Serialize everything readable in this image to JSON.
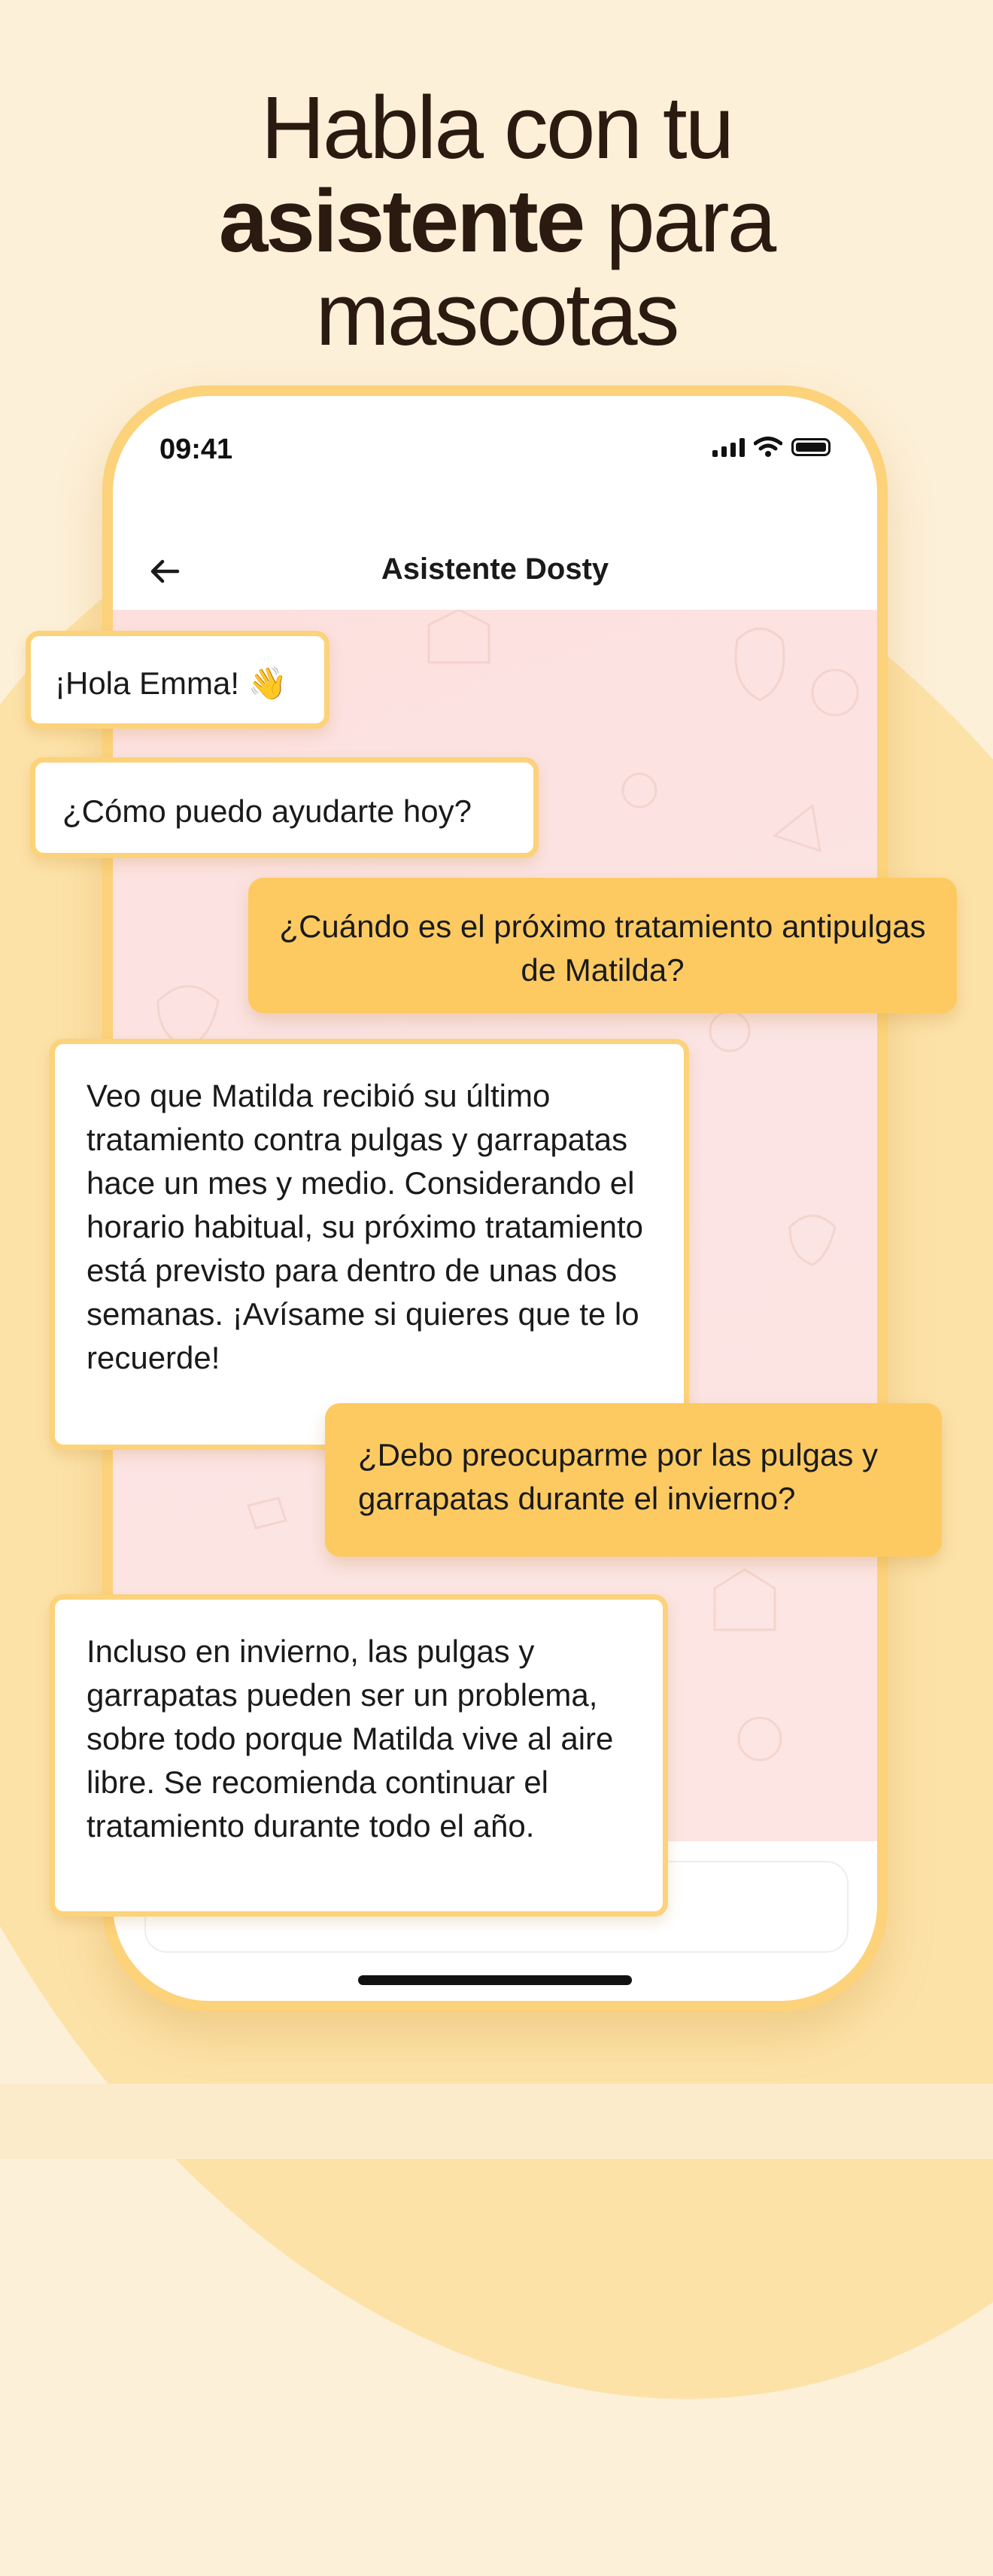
{
  "headline": {
    "line1": "Habla con tu",
    "bold": "asistente",
    "line2_rest": " para",
    "line3": "mascotas"
  },
  "status_bar": {
    "time": "09:41"
  },
  "nav": {
    "title": "Asistente Dosty",
    "back_icon": "arrow-left-icon"
  },
  "messages": [
    {
      "role": "assistant",
      "text": "¡Hola Emma! 👋"
    },
    {
      "role": "assistant",
      "text": "¿Cómo puedo ayudarte hoy?"
    },
    {
      "role": "user",
      "text": "¿Cuándo es el próximo tratamiento antipulgas de Matilda?"
    },
    {
      "role": "assistant",
      "text": "Veo que Matilda recibió su último tratamiento contra pulgas y garrapatas hace un mes y medio. Considerando el horario habitual, su próximo tratamiento está previsto para dentro de unas dos semanas. ¡Avísame si quieres que te lo recuerde!"
    },
    {
      "role": "user",
      "text": "¿Debo preocuparme por las pulgas y garrapatas durante el invierno?"
    },
    {
      "role": "assistant",
      "text": "Incluso en invierno, las pulgas y garrapatas pueden ser un problema, sobre todo porque Matilda vive al aire libre. Se recomienda continuar el tratamiento durante todo el año."
    }
  ],
  "colors": {
    "background": "#fdf0d8",
    "accent": "#fcd27a",
    "user_bubble": "#fdca62",
    "chat_background": "#fde0de"
  }
}
